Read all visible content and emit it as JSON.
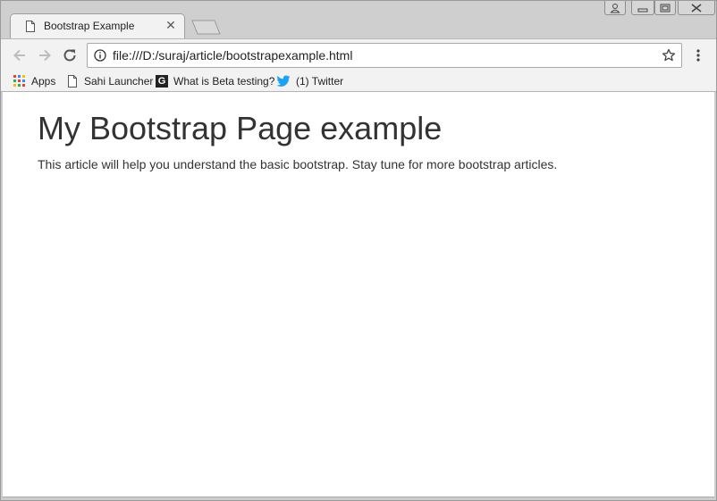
{
  "tab": {
    "title": "Bootstrap Example",
    "close_glyph": "✕",
    "favicon": "page-icon"
  },
  "window_controls": [
    "profile-icon",
    "minimize-icon",
    "restore-icon",
    "close-icon"
  ],
  "toolbar": {
    "back": "back-arrow-icon",
    "forward": "forward-arrow-icon",
    "reload": "reload-icon",
    "url": "file:///D:/suraj/article/bootstrapexample.html",
    "info": "info-icon",
    "star": "star-icon",
    "menu": "more-vert-icon"
  },
  "bookmarks": [
    {
      "label": "Apps",
      "icon": "apps-grid-icon"
    },
    {
      "label": "Sahi Launcher",
      "icon": "page-icon"
    },
    {
      "label": "What is Beta testing?",
      "icon": "g-logo-icon",
      "icon_text": "G"
    },
    {
      "label": "(1) Twitter",
      "icon": "twitter-bird-icon"
    }
  ],
  "page": {
    "heading": "My Bootstrap Page example",
    "paragraph": "This article will help you understand the basic bootstrap. Stay tune for more bootstrap articles."
  },
  "colors": {
    "twitter": "#1da1f2",
    "text": "#333333"
  }
}
